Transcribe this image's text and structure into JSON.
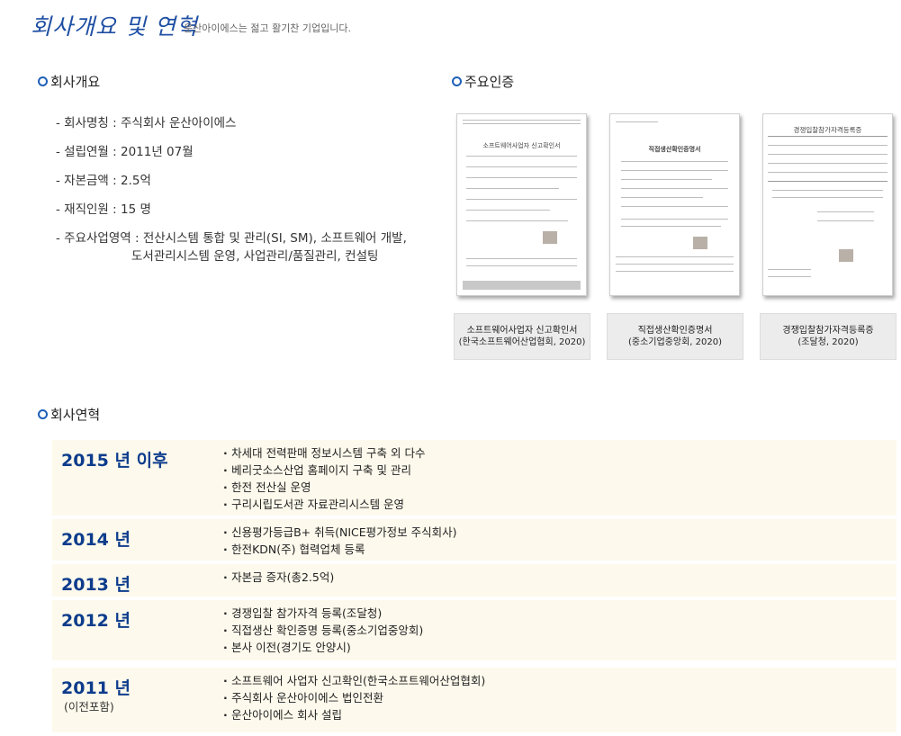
{
  "header": {
    "title": "회사개요 및 연혁",
    "subtitle": "운산아이에스는 젊고 활기찬 기업입니다."
  },
  "overview": {
    "section_title": "회사개요",
    "items": [
      "- 회사명칭 : 주식회사 운산아이에스",
      "- 설립연월 : 2011년 07월",
      "- 자본금액 : 2.5억",
      "- 재직인원 : 15 명"
    ],
    "business": {
      "first_line": "- 주요사업영역 : 전산시스템 통합 및 관리(SI, SM), 소프트웨어 개발,",
      "second_line": "도서관리시스템 운영, 사업관리/품질관리, 컨설팅"
    }
  },
  "certifications": {
    "section_title": "주요인증",
    "items": [
      {
        "doc_title": "소프트웨어사업자 신고확인서",
        "caption_line1": "소프트웨어사업자 신고확인서",
        "caption_line2": "(한국소프트웨어산업협회, 2020)"
      },
      {
        "doc_title": "직접생산확인증명서",
        "caption_line1": "직접생산확인증명서",
        "caption_line2": "(중소기업중앙회, 2020)"
      },
      {
        "doc_title": "경쟁입찰참가자격등록증",
        "caption_line1": "경쟁입찰참가자격등록증",
        "caption_line2": "(조달청, 2020)"
      }
    ]
  },
  "history": {
    "section_title": "회사연혁",
    "rows": [
      {
        "year": "2015 년 이후",
        "note": "",
        "events": [
          "차세대 전력판매 정보시스템 구축 외 다수",
          "베리굿소스산업 홈페이지 구축 및 관리",
          "한전 전산실 운영",
          "구리시립도서관 자료관리시스템 운영"
        ]
      },
      {
        "year": "2014 년",
        "note": "",
        "events": [
          "신용평가등급B+ 취득(NICE평가정보 주식회사)",
          "한전KDN(주) 협력업체 등록"
        ]
      },
      {
        "year": "2013 년",
        "note": "",
        "events": [
          "자본금 증자(총2.5억)"
        ]
      },
      {
        "year": "2012 년",
        "note": "",
        "events": [
          "경쟁입찰 참가자격 등록(조달청)",
          "직접생산 확인증명 등록(중소기업중앙회)",
          "본사 이전(경기도 안양시)"
        ]
      },
      {
        "year": "2011 년",
        "note": "(이전포함)",
        "events": [
          "소프트웨어 사업자 신고확인(한국소프트웨어산업협회)",
          "주식회사 운산아이에스 법인전환",
          "운산아이에스 회사 설립"
        ]
      }
    ]
  }
}
